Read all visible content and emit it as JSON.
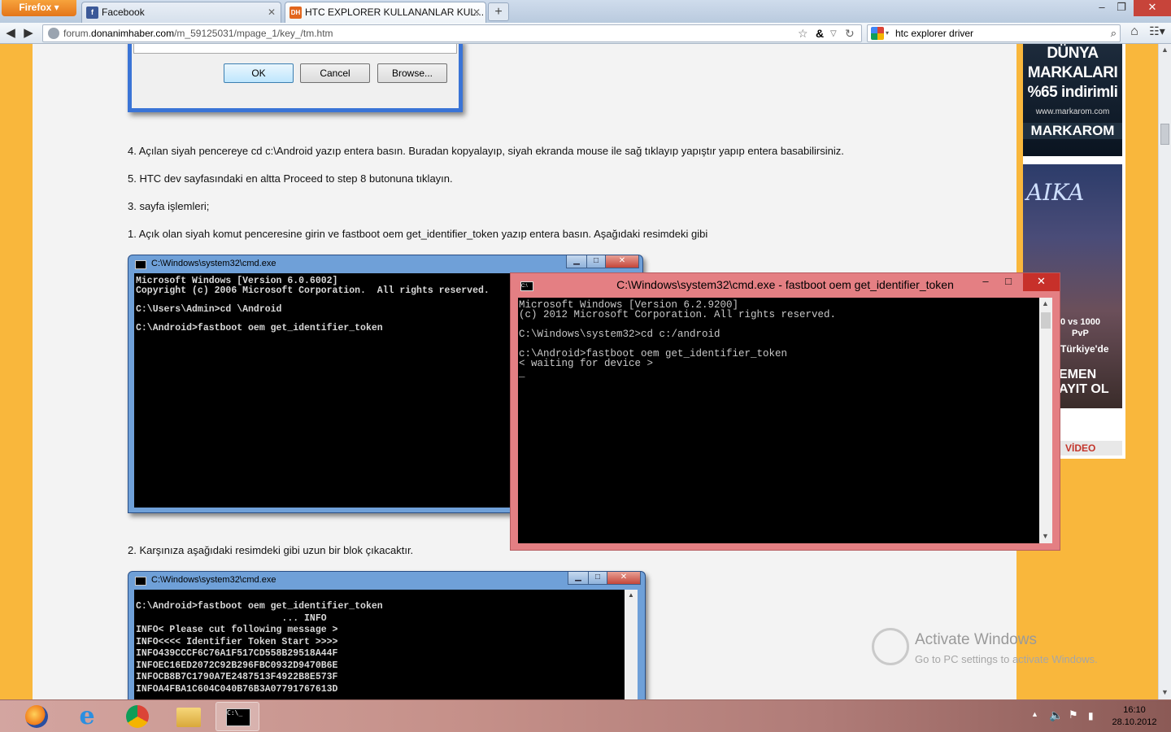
{
  "browser": {
    "app_button": "Firefox",
    "tabs": [
      {
        "label": "Facebook",
        "icon": "f"
      },
      {
        "label": "HTC EXPLORER KULLANANLAR KUL...",
        "icon": "DH"
      }
    ],
    "url_prefix": "forum.",
    "url_domain": "donanimhaber.com",
    "url_path": "/m_59125031/mpage_1/key_/tm.htm",
    "search_text": "htc explorer driver"
  },
  "dialog": {
    "ok": "OK",
    "cancel": "Cancel",
    "browse": "Browse..."
  },
  "paragraphs": {
    "p4": "4. Açılan siyah pencereye cd c:\\Android yazıp entera basın. Buradan kopyalayıp, siyah ekranda mouse ile sağ tıklayıp yapıştır yapıp entera basabilirsiniz.",
    "p5": "5. HTC dev sayfasındaki en altta Proceed to step 8 butonuna tıklayın.",
    "p_heading3": "3. sayfa işlemleri;",
    "p1": "1. Açık olan siyah komut penceresine girin ve fastboot oem get_identifier_token yazıp entera basın. Aşağıdaki resimdeki gibi",
    "p2": "2. Karşınıza aşağıdaki resimdeki gibi uzun bir blok çıkacaktır."
  },
  "cmd1": {
    "title": "C:\\Windows\\system32\\cmd.exe",
    "text": "Microsoft Windows [Version 6.0.6002]\nCopyright (c) 2006 Microsoft Corporation.  All rights reserved.\n\nC:\\Users\\Admin>cd \\Android\n\nC:\\Android>fastboot oem get_identifier_token"
  },
  "cmd2": {
    "title": "C:\\Windows\\system32\\cmd.exe",
    "text": "C:\\Android>fastboot oem get_identifier_token\n                          ... INFO\nINFO< Please cut following message >\nINFO<<<< Identifier Token Start >>>>\nINFO439CCCF6C76A1F517CD558B29518A44F\nINFOEC16ED2072C92B296FBC0932D9470B6E\nINFOCB8B7C1790A7E2487513F4922B8E573F\nINFOA4FBA1C604C040B76B3A07791767613D"
  },
  "cmd_win8": {
    "title": "C:\\Windows\\system32\\cmd.exe - fastboot  oem get_identifier_token",
    "text": "Microsoft Windows [Version 6.2.9200]\n(c) 2012 Microsoft Corporation. All rights reserved.\n\nC:\\Windows\\system32>cd c:/android\n\nc:\\Android>fastboot oem get_identifier_token\n< waiting for device >\n_"
  },
  "ads": {
    "ad1_lines": [
      "DÜNYA",
      "MARKALARI",
      "%65 indirimli"
    ],
    "ad1_url": "www.markarom.com",
    "ad1_brand": "MARKAROM",
    "ad2_logo": "AIKA",
    "ad2_vs": "0 vs 1000",
    "ad2_pvp": "PvP",
    "ad2_tr": "Türkiye'de",
    "ad2_reg": [
      "EMEN",
      "AYIT OL"
    ],
    "ad3": "VİDEO"
  },
  "watermark": {
    "title": "Activate Windows",
    "subtitle": "Go to PC settings to activate Windows."
  },
  "taskbar": {
    "time": "16:10",
    "date": "28.10.2012"
  },
  "colors": {
    "page_bg": "#f9b73c",
    "win8_frame": "#e47f83",
    "win7_frame": "#6fa0d8"
  }
}
